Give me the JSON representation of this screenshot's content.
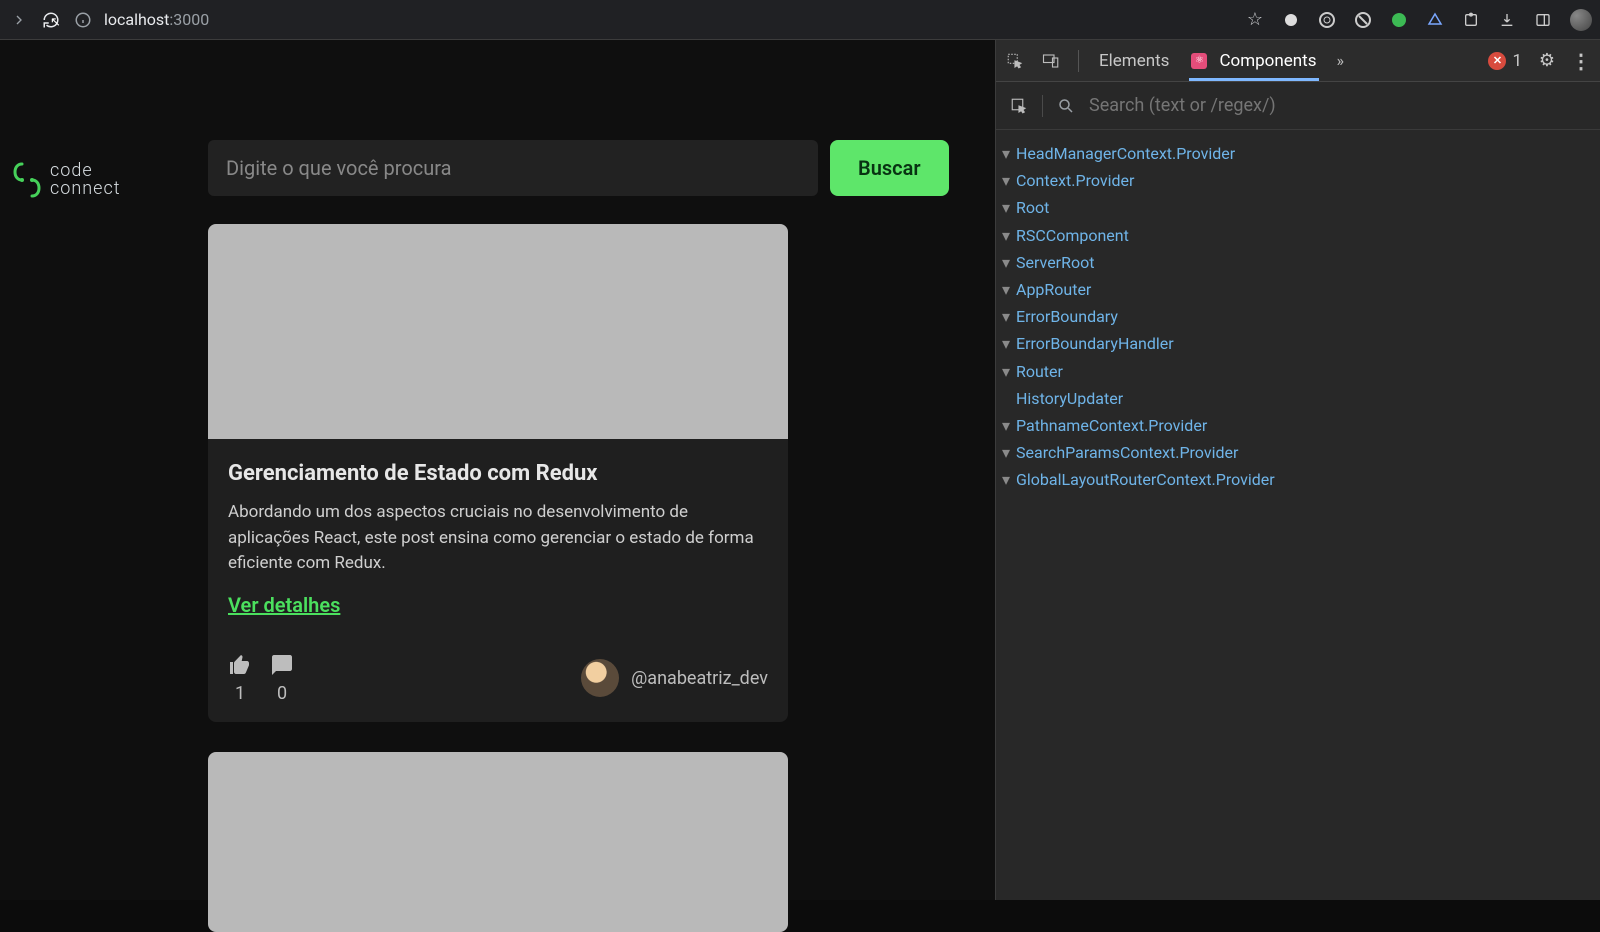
{
  "browser": {
    "url_host": "localhost",
    "url_port": ":3000"
  },
  "app": {
    "logo": {
      "line1": "code",
      "line2": "connect"
    },
    "search": {
      "placeholder": "Digite o que você procura",
      "button": "Buscar"
    },
    "card": {
      "title": "Gerenciamento de Estado com Redux",
      "description": "Abordando um dos aspectos cruciais no desenvolvimento de aplicações React, este post ensina como gerenciar o estado de forma eficiente com Redux.",
      "details_link": "Ver detalhes",
      "likes": "1",
      "comments": "0",
      "author": "@anabeatriz_dev"
    }
  },
  "devtools": {
    "tabs": {
      "elements": "Elements",
      "components": "Components",
      "more": "»"
    },
    "error_count": "1",
    "search_placeholder": "Search (text or /regex/)",
    "tree": [
      {
        "depth": 0,
        "label": "HeadManagerContext.Provider",
        "expanded": true
      },
      {
        "depth": 1,
        "label": "Context.Provider",
        "expanded": true
      },
      {
        "depth": 2,
        "label": "Root",
        "expanded": true
      },
      {
        "depth": 3,
        "label": "RSCComponent",
        "expanded": true
      },
      {
        "depth": 4,
        "label": "ServerRoot",
        "expanded": true
      },
      {
        "depth": 5,
        "label": "AppRouter",
        "expanded": true
      },
      {
        "depth": 6,
        "label": "ErrorBoundary",
        "expanded": true
      },
      {
        "depth": 7,
        "label": "ErrorBoundaryHandler",
        "expanded": true
      },
      {
        "depth": 8,
        "label": "Router",
        "expanded": true
      },
      {
        "depth": 9,
        "label": "HistoryUpdater",
        "expanded": false
      },
      {
        "depth": 9,
        "label": "PathnameContext.Provider",
        "expanded": true
      },
      {
        "depth": 10,
        "label": "SearchParamsContext.Provider",
        "expanded": true
      },
      {
        "depth": 11,
        "label": "GlobalLayoutRouterContext.Provider",
        "expanded": true
      }
    ]
  }
}
